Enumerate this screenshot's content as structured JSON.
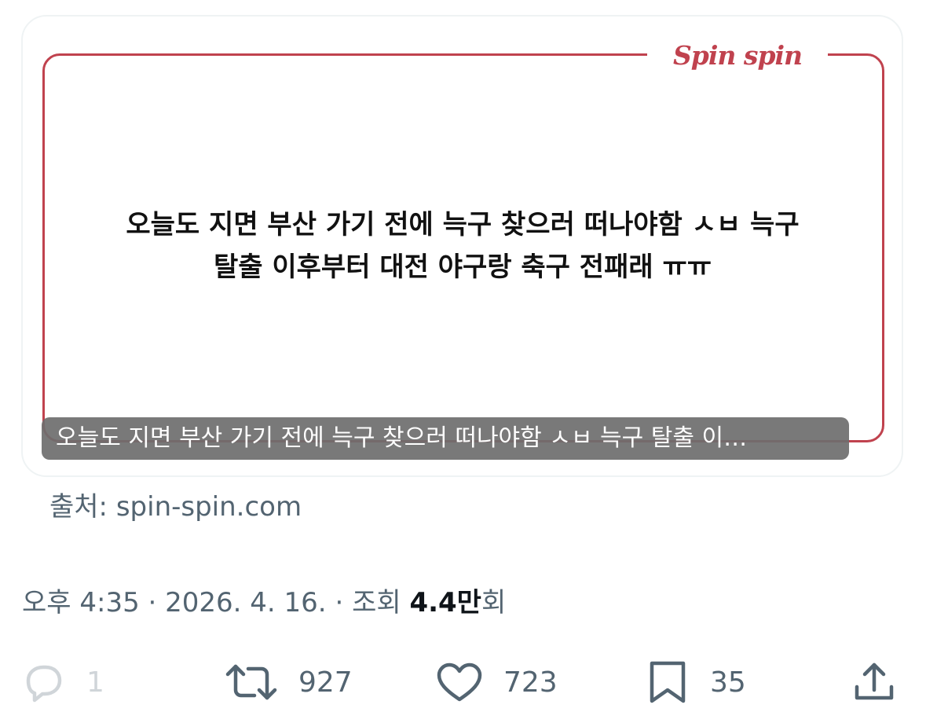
{
  "card": {
    "brand": "Spin spin",
    "body_lines": [
      "오늘도 지면 부산 가기 전에 늑구 찾으러 떠나야함 ㅅㅂ 늑구",
      "탈출 이후부터 대전 야구랑 축구 전패래 ㅠㅠ"
    ],
    "alt_text": "오늘도 지면 부산 가기 전에 늑구 찾으러 떠나야함 ㅅㅂ 늑구 탈출 이…"
  },
  "source": "출처: spin-spin.com",
  "meta": {
    "time": "오후 4:35",
    "date": "2026. 4. 16.",
    "views_label": "조회",
    "views_count": "4.4만",
    "views_suffix": "회"
  },
  "actions": {
    "reply_count": "1",
    "repost_count": "927",
    "like_count": "723",
    "bookmark_count": "35"
  },
  "icons": {
    "reply": "reply-bubble-icon",
    "repost": "repost-arrows-icon",
    "like": "heart-icon",
    "bookmark": "bookmark-icon",
    "share": "share-upload-icon"
  },
  "colors": {
    "brand_red": "#c0424e",
    "muted_text": "#536471",
    "primary_text": "#0f1419"
  }
}
